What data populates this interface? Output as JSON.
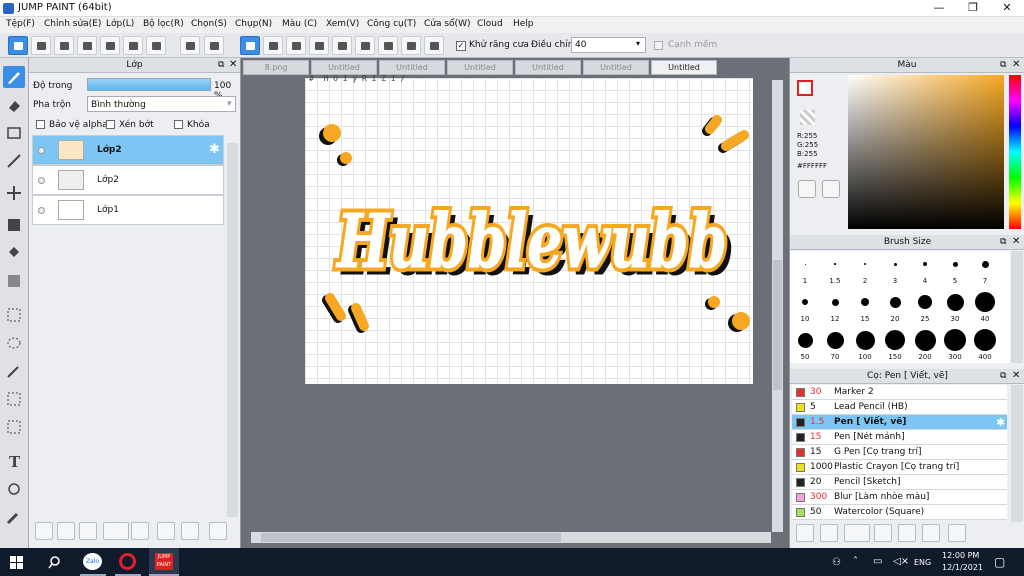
{
  "window": {
    "title": "JUMP PAINT (64bit)"
  },
  "menu": [
    "Tệp(F)",
    "Chỉnh sửa(E)",
    "Lớp(L)",
    "Bộ lọc(R)",
    "Chọn(S)",
    "Chụp(N)",
    "Màu (C)",
    "Xem(V)",
    "Công cụ(T)",
    "Cửa sổ(W)",
    "Cloud",
    "Help"
  ],
  "toolbar": {
    "antialias_label": "Khử răng cưa",
    "adjust_label": "Điều chỉnh",
    "adjust_value": "40",
    "snap_label": "Cạnh mềm"
  },
  "layer_panel": {
    "title": "Lớp",
    "opacity_label": "Độ trong",
    "opacity_value": "100 %",
    "blend_label": "Pha trộn",
    "blend_value": "Bình thường",
    "protect_alpha": "Bảo vệ alpha",
    "clip": "Xén bớt",
    "lock": "Khóa",
    "layers": [
      {
        "name": "Lớp2",
        "selected": true
      },
      {
        "name": "Lớp2",
        "selected": false
      },
      {
        "name": "Lớp1",
        "selected": false
      }
    ]
  },
  "canvas": {
    "tabs": [
      "8.png",
      "Untitled",
      "Untitled",
      "Untitled",
      "Untitled",
      "Untitled",
      "Untitled"
    ],
    "active_tab": 6,
    "artwork_text": "Hubblewubb",
    "top_fragment": "#  H O I y R I Z I /"
  },
  "color_panel": {
    "title": "Màu",
    "r": "R:255",
    "g": "G:255",
    "b": "B:255",
    "hex": "#FFFFFF"
  },
  "brush_size_panel": {
    "title": "Brush Size",
    "sizes": [
      "1",
      "1.5",
      "2",
      "3",
      "4",
      "5",
      "7",
      "10",
      "12",
      "15",
      "20",
      "25",
      "30",
      "40",
      "50",
      "70",
      "100",
      "150",
      "200",
      "300",
      "400"
    ]
  },
  "brush_panel": {
    "title": "Cọ: Pen [ Viết, vẽ]",
    "items": [
      {
        "size": "30",
        "name": "Marker 2",
        "color": "#e03030",
        "sizecolor": "#e03030"
      },
      {
        "size": "5",
        "name": "Lead Pencil (HB)",
        "color": "#f0e020",
        "sizecolor": "#111"
      },
      {
        "size": "1.5",
        "name": "Pen [ Viết, vẽ]",
        "color": "#222222",
        "sizecolor": "#e03030",
        "selected": true
      },
      {
        "size": "15",
        "name": "Pen [Nét mảnh]",
        "color": "#222222",
        "sizecolor": "#e03030"
      },
      {
        "size": "15",
        "name": "G Pen [Cọ trang trí]",
        "color": "#e03030",
        "sizecolor": "#111"
      },
      {
        "size": "1000",
        "name": "Plastic Crayon [Cọ trang trí]",
        "color": "#f0e020",
        "sizecolor": "#111"
      },
      {
        "size": "20",
        "name": "Pencil [Sketch]",
        "color": "#222222",
        "sizecolor": "#111"
      },
      {
        "size": "300",
        "name": "Blur [Làm nhòe màu]",
        "color": "#f4a0e0",
        "sizecolor": "#e03030"
      },
      {
        "size": "50",
        "name": "Watercolor (Square)",
        "color": "#a8e060",
        "sizecolor": "#111"
      }
    ]
  },
  "taskbar": {
    "time": "12:00 PM",
    "date": "12/1/2021",
    "lang": "ENG",
    "apps": [
      "Zalo",
      "Opera",
      "JUMP PAINT"
    ]
  },
  "colors": {
    "accent": "#3b8ee6",
    "selection": "#7dc6f4",
    "art_orange": "#f7a823",
    "art_black": "#111111"
  }
}
